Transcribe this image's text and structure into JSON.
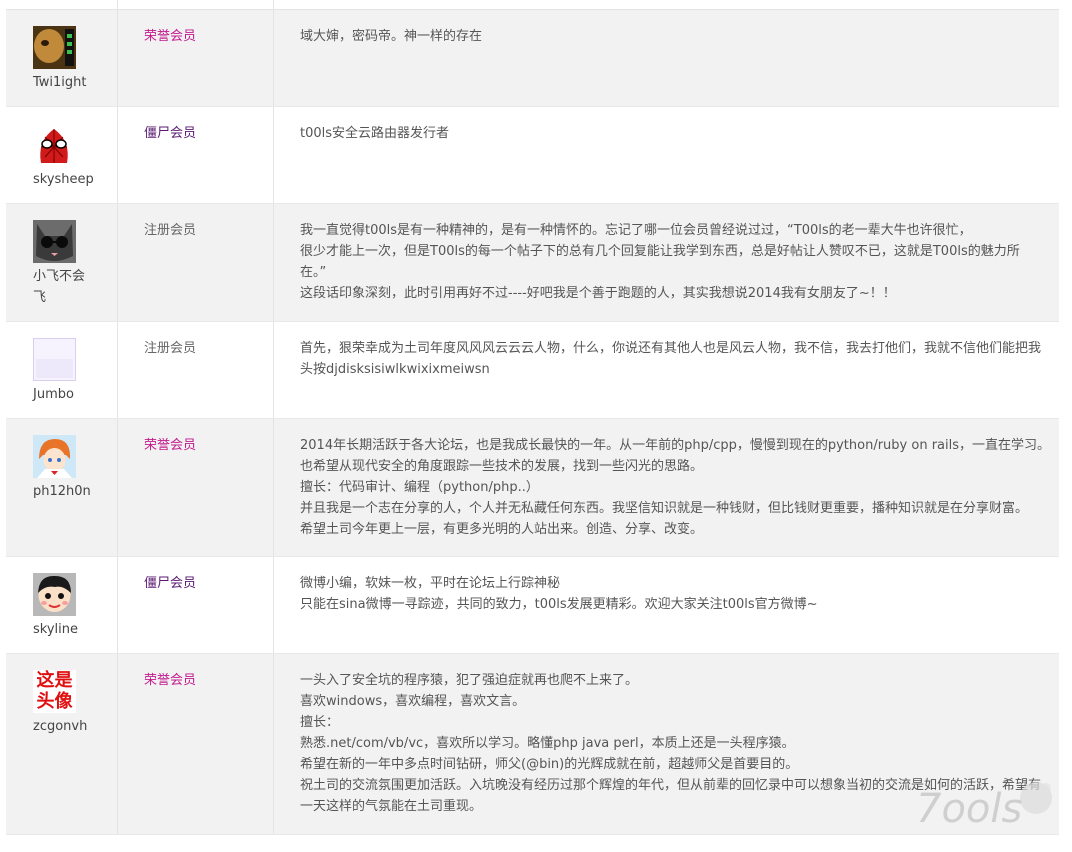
{
  "ranks": {
    "honor_color": "#c21a8d",
    "zombie_color": "#5a1a72",
    "registered_color": "#666666"
  },
  "rows": [
    {
      "username": "Twi1ight",
      "avatar": "dark-cat-avatar-icon",
      "rank": "荣誉会员",
      "message": [
        "域大婶，密码帝。神一样的存在"
      ]
    },
    {
      "username": "skysheep",
      "avatar": "spiderman-avatar-icon",
      "rank": "僵尸会员",
      "message": [
        "t00ls安全云路由器发行者"
      ]
    },
    {
      "username_lines": [
        "小飞不会",
        "飞"
      ],
      "avatar": "cat-sunglasses-avatar-icon",
      "rank": "注册会员",
      "message": [
        "我一直觉得t00ls是有一种精神的，是有一种情怀的。忘记了哪一位会员曾经说过过，“T00ls的老一辈大牛也许很忙，",
        "很少才能上一次，但是T00ls的每一个帖子下的总有几个回复能让我学到东西，总是好帖让人赞叹不已，这就是T00ls的魅力所",
        "在。”",
        "这段话印象深刻，此时引用再好不过----好吧我是个善于跑题的人，其实我想说2014我有女朋友了~！！"
      ]
    },
    {
      "username": "Jumbo",
      "avatar": "blank-avatar-icon",
      "rank": "注册会员",
      "message": [
        "首先，狠荣幸成为土司年度风风风云云云人物，什么，你说还有其他人也是风云人物，我不信，我去打他们，我就不信他们能把我",
        "头按djdisksisiwlkwixixmeiwsn"
      ]
    },
    {
      "username": "ph12h0n",
      "avatar": "anime-girl-avatar-icon",
      "rank": "荣誉会员",
      "message": [
        "2014年长期活跃于各大论坛，也是我成长最快的一年。从一年前的php/cpp，慢慢到现在的python/ruby on rails，一直在学习。",
        "也希望从现代安全的角度跟踪一些技术的发展，找到一些闪光的思路。",
        "擅长：代码审计、编程（python/php..）",
        "并且我是一个志在分享的人，个人并无私藏任何东西。我坚信知识就是一种钱财，但比钱财更重要，播种知识就是在分享财富。",
        "希望土司今年更上一层，有更多光明的人站出来。创造、分享、改变。"
      ]
    },
    {
      "username": "skyline",
      "avatar": "cartoon-boy-avatar-icon",
      "rank": "僵尸会员",
      "message": [
        "微博小编，软妹一枚，平时在论坛上行踪神秘",
        "只能在sina微博一寻踪迹，共同的致力，t00ls发展更精彩。欢迎大家关注t00ls官方微博~"
      ]
    },
    {
      "username": "zcgonvh",
      "avatar_text": [
        "这是",
        "头像"
      ],
      "avatar": "text-avatar-icon",
      "rank": "荣誉会员",
      "message": [
        "一头入了安全坑的程序猿，犯了强迫症就再也爬不上来了。",
        "喜欢windows，喜欢编程，喜欢文言。",
        "擅长：",
        "熟悉.net/com/vb/vc，喜欢所以学习。略懂php java perl，本质上还是一头程序猿。",
        "希望在新的一年中多点时间钻研，师父(@bin)的光辉成就在前，超越师父是首要目的。",
        "祝土司的交流氛围更加活跃。入坑晚没有经历过那个辉煌的年代，但从前辈的回忆录中可以想象当初的交流是如何的活跃，希望有",
        "一天这样的气氛能在土司重现。"
      ]
    }
  ],
  "watermark": "7ools"
}
